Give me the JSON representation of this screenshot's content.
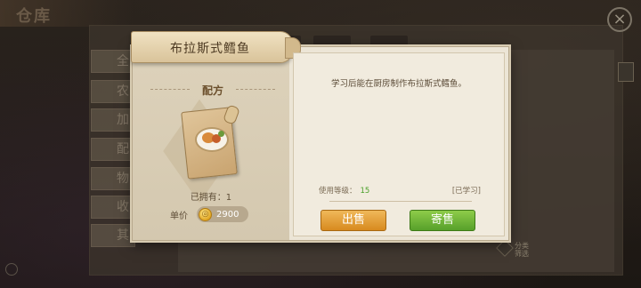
{
  "background": {
    "title": "仓库",
    "tabs": [
      "全",
      "农",
      "加",
      "配",
      "物",
      "收",
      "其"
    ],
    "close_label": "×",
    "bottom_right_text": "分类\n筛选"
  },
  "modal": {
    "item_name": "布拉斯式鳕鱼",
    "category": "配方",
    "owned_text": "已拥有：1",
    "price_label": "单价",
    "price_value": "2900",
    "description": "学习后能在厨房制作布拉斯式鳕鱼。",
    "level_label": "使用等级：",
    "level_value": "15",
    "learned_text": "[已学习]",
    "sell_button": "出售",
    "consign_button": "寄售"
  },
  "colors": {
    "sell_button": "#e09a2e",
    "consign_button": "#6fb235",
    "level_value": "#4aa02a"
  },
  "icons": [
    "coin-icon",
    "close-icon",
    "recipe-scroll-icon"
  ]
}
